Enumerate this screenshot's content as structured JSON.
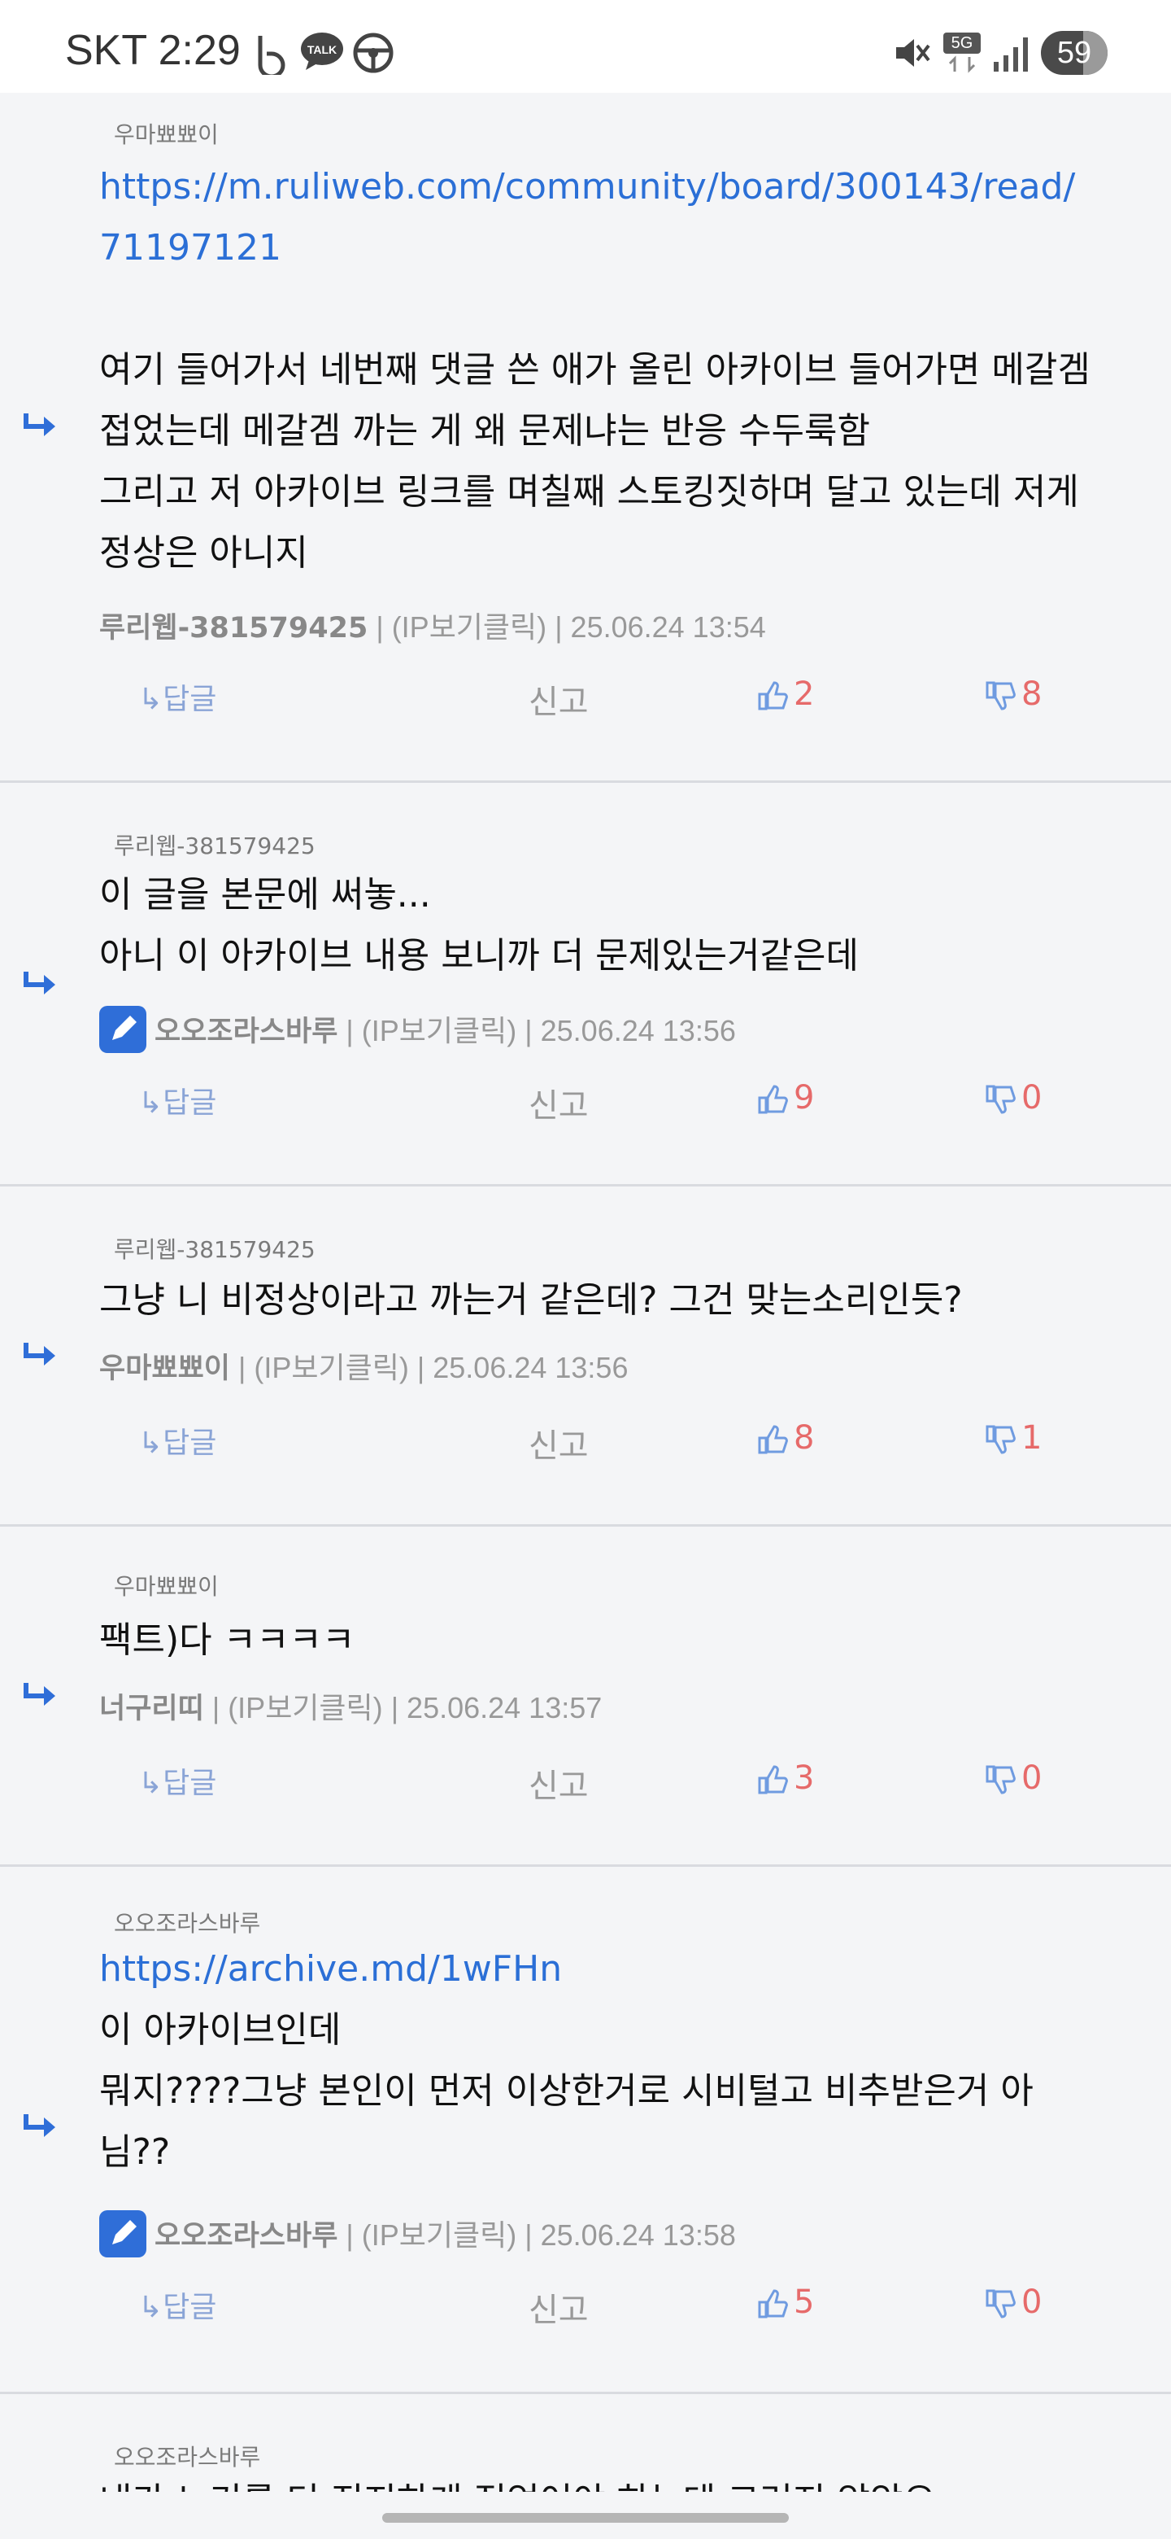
{
  "status_bar": {
    "carrier_time": "SKT 2:29",
    "network": "5G",
    "battery": "59"
  },
  "comments": [
    {
      "reply_to": "우마뾰뾰이",
      "link_lines": [
        "https://m.ruliweb.com/community/board/300143/read/",
        "71197121"
      ],
      "lines": [
        "여기 들어가서 네번째 댓글 쓴 애가 올린 아카이브 들어가면 메갈겜",
        "접었는데 메갈겜 까는 게 왜 문제냐는 반응 수두룩함",
        "그리고 저 아카이브 링크를 며칠째 스토킹짓하며 달고 있는데 저게",
        "정상은 아니지"
      ],
      "author": "루리웹-381579425",
      "ip": "(IP보기클릭)",
      "date": "25.06.24 13:54",
      "reply_label": "↳답글",
      "report_label": "신고",
      "up": "2",
      "down": "8"
    },
    {
      "reply_to": "루리웹-381579425",
      "lines": [
        "이 글을 본문에 써놓...",
        "아니 이 아카이브 내용 보니까 더 문제있는거같은데"
      ],
      "author": "오오조라스바루",
      "ip": "(IP보기클릭)",
      "date": "25.06.24 13:56",
      "reply_label": "↳답글",
      "report_label": "신고",
      "up": "9",
      "down": "0"
    },
    {
      "reply_to": "루리웹-381579425",
      "lines": [
        "그냥 니 비정상이라고 까는거 같은데? 그건 맞는소리인듯?"
      ],
      "author": "우마뾰뾰이",
      "ip": "(IP보기클릭)",
      "date": "25.06.24 13:56",
      "reply_label": "↳답글",
      "report_label": "신고",
      "up": "8",
      "down": "1"
    },
    {
      "reply_to": "우마뾰뾰이",
      "lines": [
        "팩트)다 ㅋㅋㅋㅋ"
      ],
      "author": "너구리띠",
      "ip": "(IP보기클릭)",
      "date": "25.06.24 13:57",
      "reply_label": "↳답글",
      "report_label": "신고",
      "up": "3",
      "down": "0"
    },
    {
      "reply_to": "오오조라스바루",
      "link_lines": [
        "https://archive.md/1wFHn"
      ],
      "lines": [
        "이 아카이브인데",
        "뭐지????그냥 본인이 먼저 이상한거로 시비털고 비추받은거 아",
        "님??"
      ],
      "author": "오오조라스바루",
      "ip": "(IP보기클릭)",
      "date": "25.06.24 13:58",
      "reply_label": "↳답글",
      "report_label": "신고",
      "up": "5",
      "down": "0"
    },
    {
      "reply_to": "오오조라스바루",
      "lines": [
        "내가 노기를 더 진지하게 적었어야 하는데 그러지 않았으"
      ]
    }
  ],
  "colors": {
    "link": "#2b6fd6",
    "vote_count": "#e66a6a",
    "badge": "#2f6ed8"
  }
}
